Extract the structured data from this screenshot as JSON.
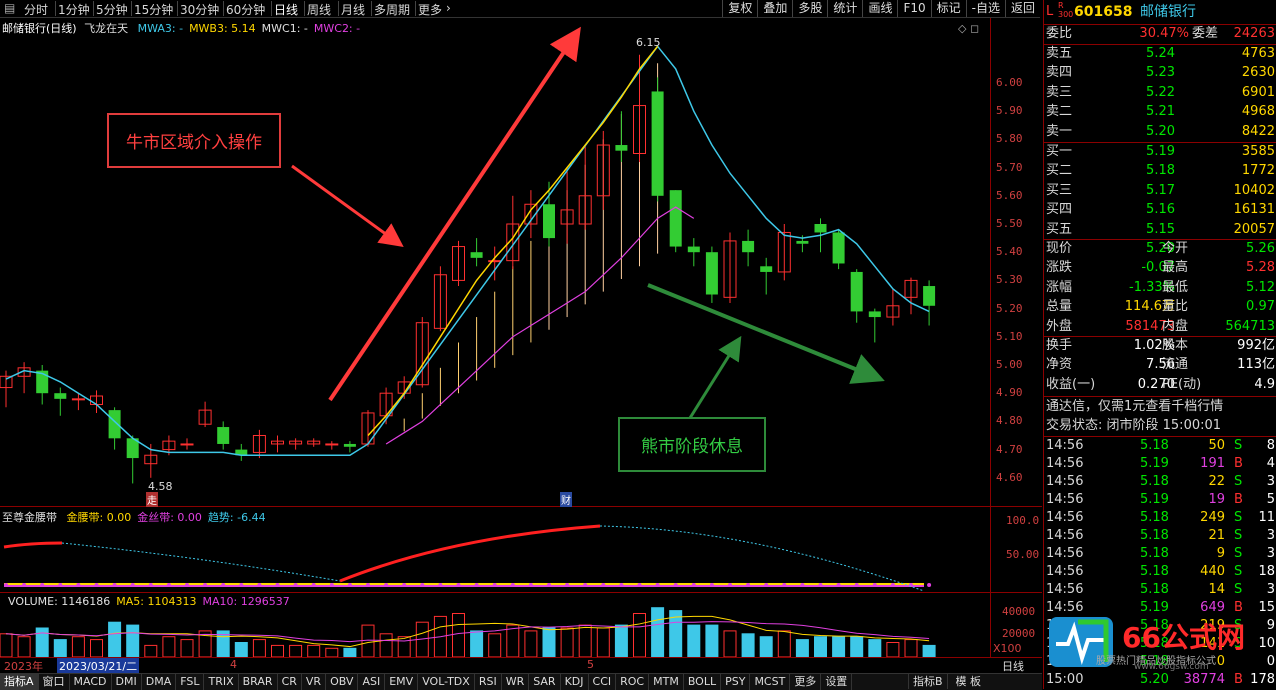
{
  "toolbar": {
    "periods": [
      "分时",
      "1分钟",
      "5分钟",
      "15分钟",
      "30分钟",
      "60分钟",
      "日线",
      "周线",
      "月线",
      "多周期",
      "更多"
    ],
    "active_period": "日线",
    "right_buttons": [
      "复权",
      "叠加",
      "多股",
      "统计",
      "画线",
      "F10",
      "标记",
      "-自选",
      "返回"
    ]
  },
  "main_chart": {
    "title": "邮储银行(日线)",
    "indicator": "飞龙在天",
    "legend": [
      {
        "text": "MWA3: -",
        "color": "#3ec8e8"
      },
      {
        "text": "MWB3: 5.14",
        "color": "#ffd700"
      },
      {
        "text": "MWC1: -",
        "color": "#e0e0e0"
      },
      {
        "text": "MWC2: -",
        "color": "#e040e0"
      }
    ],
    "high_label": "6.15",
    "low_label": "4.58",
    "marker_zou": "走",
    "marker_cai": "财",
    "yticks": [
      "6.00",
      "5.90",
      "5.80",
      "5.70",
      "5.60",
      "5.50",
      "5.40",
      "5.30",
      "5.20",
      "5.10",
      "5.00",
      "4.90",
      "4.80",
      "4.70",
      "4.60"
    ]
  },
  "annotations": {
    "bull": "牛市区域介入操作",
    "bear": "熊市阶段休息"
  },
  "mid_chart": {
    "name": "至尊金腰带",
    "legend": [
      {
        "text": "金腰带: 0.00",
        "color": "#ffd700"
      },
      {
        "text": "金丝带: 0.00",
        "color": "#e040e0"
      },
      {
        "text": "趋势: -6.44",
        "color": "#3ec8e8"
      }
    ],
    "yticks": [
      "100.0",
      "50.00"
    ]
  },
  "volume_chart": {
    "legend": [
      {
        "text": "VOLUME: 1146186",
        "color": "#e0e0e0"
      },
      {
        "text": "MA5: 1104313",
        "color": "#ffd700"
      },
      {
        "text": "MA10: 1296537",
        "color": "#e040e0"
      }
    ],
    "yticks": [
      "40000",
      "20000"
    ],
    "unit": "X100"
  },
  "timeline": {
    "year": "2023年",
    "date": "2023/03/21/二",
    "month4": "4",
    "month5": "5",
    "period_btn": "日线"
  },
  "bottom_tabs": [
    "指标A",
    "窗口",
    "MACD",
    "DMI",
    "DMA",
    "FSL",
    "TRIX",
    "BRAR",
    "CR",
    "VR",
    "OBV",
    "ASI",
    "EMV",
    "VOL-TDX",
    "RSI",
    "WR",
    "SAR",
    "KDJ",
    "CCI",
    "ROC",
    "MTM",
    "BOLL",
    "PSY",
    "MCST",
    "更多",
    "设置"
  ],
  "bottom_right": [
    "指标B",
    "模 板"
  ],
  "quote": {
    "code": "601658",
    "name": "邮储银行",
    "weibi_label": "委比",
    "weibi": "30.47%",
    "weicha_label": "委差",
    "weicha": "24263",
    "asks": [
      {
        "label": "卖五",
        "price": "5.24",
        "vol": "4763"
      },
      {
        "label": "卖四",
        "price": "5.23",
        "vol": "2630"
      },
      {
        "label": "卖三",
        "price": "5.22",
        "vol": "6901"
      },
      {
        "label": "卖二",
        "price": "5.21",
        "vol": "4968"
      },
      {
        "label": "卖一",
        "price": "5.20",
        "vol": "8422"
      }
    ],
    "bids": [
      {
        "label": "买一",
        "price": "5.19",
        "vol": "3585"
      },
      {
        "label": "买二",
        "price": "5.18",
        "vol": "1772"
      },
      {
        "label": "买三",
        "price": "5.17",
        "vol": "10402"
      },
      {
        "label": "买四",
        "price": "5.16",
        "vol": "16131"
      },
      {
        "label": "买五",
        "price": "5.15",
        "vol": "20057"
      }
    ],
    "stats": [
      {
        "l1": "现价",
        "v1": "5.20",
        "c1": "grn",
        "l2": "今开",
        "v2": "5.26",
        "c2": "grn"
      },
      {
        "l1": "涨跌",
        "v1": "-0.07",
        "c1": "grn",
        "l2": "最高",
        "v2": "5.28",
        "c2": "red"
      },
      {
        "l1": "涨幅",
        "v1": "-1.33%",
        "c1": "grn",
        "l2": "最低",
        "v2": "5.12",
        "c2": "grn"
      },
      {
        "l1": "总量",
        "v1": "114.6万",
        "c1": "yel",
        "l2": "量比",
        "v2": "0.97",
        "c2": "grn"
      },
      {
        "l1": "外盘",
        "v1": "581473",
        "c1": "red",
        "l2": "内盘",
        "v2": "564713",
        "c2": "grn"
      }
    ],
    "stats2": [
      {
        "l1": "换手",
        "v1": "1.02%",
        "l2": "股本",
        "v2": "992亿"
      },
      {
        "l1": "净资",
        "v1": "7.56",
        "l2": "流通",
        "v2": "113亿"
      },
      {
        "l1": "收益(一)",
        "v1": "0.270",
        "l2": "PE(动)",
        "v2": "4.9"
      }
    ],
    "promo": "通达信，仅需1元查看千档行情",
    "status": "交易状态: 闭市阶段 15:00:01",
    "ticks": [
      {
        "t": "14:56",
        "p": "5.18",
        "v": "50",
        "d": "S",
        "n": "8"
      },
      {
        "t": "14:56",
        "p": "5.19",
        "v": "191",
        "d": "B",
        "n": "4"
      },
      {
        "t": "14:56",
        "p": "5.18",
        "v": "22",
        "d": "S",
        "n": "3"
      },
      {
        "t": "14:56",
        "p": "5.19",
        "v": "19",
        "d": "B",
        "n": "5"
      },
      {
        "t": "14:56",
        "p": "5.18",
        "v": "249",
        "d": "S",
        "n": "11"
      },
      {
        "t": "14:56",
        "p": "5.18",
        "v": "21",
        "d": "S",
        "n": "3"
      },
      {
        "t": "14:56",
        "p": "5.18",
        "v": "9",
        "d": "S",
        "n": "3"
      },
      {
        "t": "14:56",
        "p": "5.18",
        "v": "440",
        "d": "S",
        "n": "18"
      },
      {
        "t": "14:56",
        "p": "5.18",
        "v": "14",
        "d": "S",
        "n": "3"
      },
      {
        "t": "14:56",
        "p": "5.19",
        "v": "649",
        "d": "B",
        "n": "15"
      },
      {
        "t": "14:56",
        "p": "5.18",
        "v": "219",
        "d": "S",
        "n": "9"
      },
      {
        "t": "14:56",
        "p": "5.18",
        "v": "141",
        "d": "S",
        "n": "10"
      },
      {
        "t": "14:57",
        "p": "5.18",
        "v": "0",
        "d": "",
        "n": "0"
      },
      {
        "t": "15:00",
        "p": "5.20",
        "v": "38774",
        "d": "B",
        "n": "178"
      }
    ]
  },
  "watermark": {
    "brand": "66公式网",
    "sub": "股票热门精品炒股指标公式",
    "url": "www.66gsw.com"
  },
  "colors": {
    "up": "#ff3030",
    "down": "#33cc33",
    "cyan": "#3ec8e8",
    "yellow": "#ffd700",
    "magenta": "#e040e0",
    "axis": "#8b0000"
  }
}
